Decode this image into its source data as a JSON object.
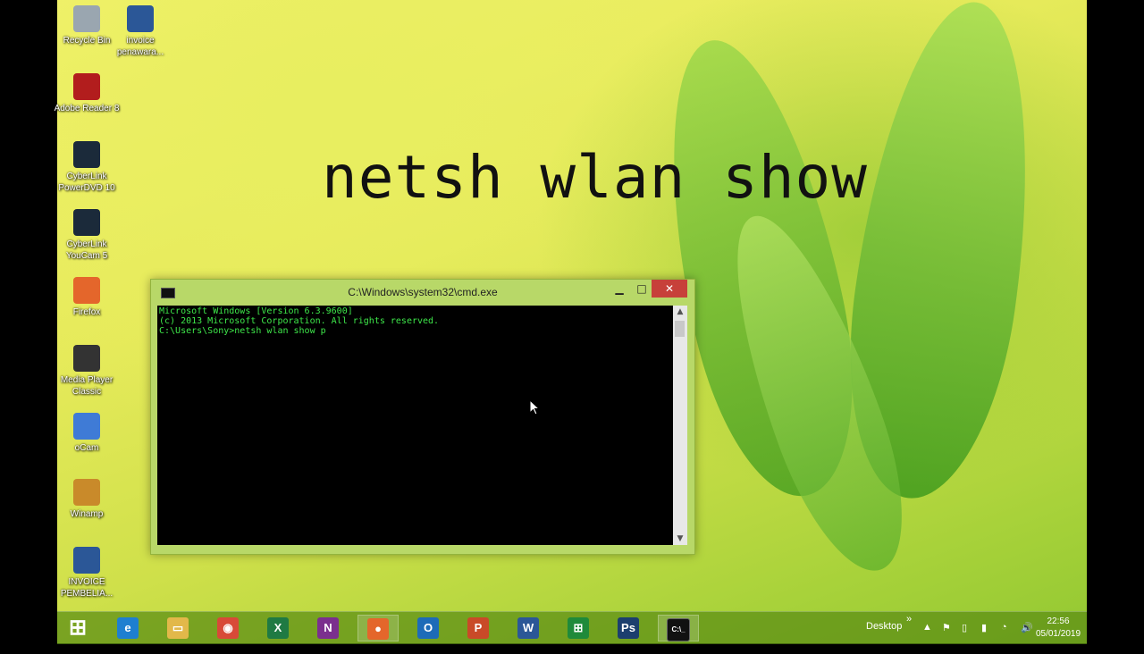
{
  "overlay_caption": "netsh wlan show",
  "desktop_icons": [
    {
      "name": "recycle-bin",
      "label": "Recycle Bin",
      "color": "#9aa6b0"
    },
    {
      "name": "invoice-penawaran",
      "label": "invoice penawara...",
      "color": "#2b5797"
    },
    {
      "name": "adobe-reader",
      "label": "Adobe Reader 8",
      "color": "#b21d1d"
    },
    {
      "name": "cyberlink-powerdvd",
      "label": "CyberLink PowerDVD 10",
      "color": "#1b2a3a"
    },
    {
      "name": "cyberlink-youcam",
      "label": "CyberLink YouCam 5",
      "color": "#1b2a3a"
    },
    {
      "name": "firefox",
      "label": "Firefox",
      "color": "#e4662b"
    },
    {
      "name": "media-player-classic",
      "label": "Media Player Classic",
      "color": "#333333"
    },
    {
      "name": "ocam",
      "label": "oCam",
      "color": "#3f7bd6"
    },
    {
      "name": "winamp",
      "label": "Winamp",
      "color": "#c98a2a"
    },
    {
      "name": "invoice-pembelian",
      "label": "INVOICE PEMBELIA...",
      "color": "#2b5797"
    }
  ],
  "cmd_window": {
    "title": "C:\\Windows\\system32\\cmd.exe",
    "minimize": "▁",
    "maximize": "□",
    "close": "✕",
    "lines": [
      "Microsoft Windows [Version 6.3.9600]",
      "(c) 2013 Microsoft Corporation. All rights reserved.",
      "",
      "C:\\Users\\Sony>netsh wlan show p"
    ]
  },
  "taskbar": {
    "apps": [
      {
        "name": "start-button",
        "icon": "windows-logo-icon",
        "glyph": "⊞",
        "color": "#ffffff"
      },
      {
        "name": "internet-explorer",
        "icon": "ie-icon",
        "glyph": "e",
        "color": "#1e7fd0"
      },
      {
        "name": "file-explorer",
        "icon": "folder-icon",
        "glyph": "▭",
        "color": "#e2b84a"
      },
      {
        "name": "chrome",
        "icon": "chrome-icon",
        "glyph": "◉",
        "color": "#d84a38"
      },
      {
        "name": "excel",
        "icon": "excel-icon",
        "glyph": "X",
        "color": "#1f7a43"
      },
      {
        "name": "onenote",
        "icon": "onenote-icon",
        "glyph": "N",
        "color": "#7b2f8e"
      },
      {
        "name": "firefox",
        "icon": "firefox-icon",
        "glyph": "●",
        "color": "#e4662b"
      },
      {
        "name": "outlook",
        "icon": "outlook-icon",
        "glyph": "O",
        "color": "#1d6bb8"
      },
      {
        "name": "powerpoint",
        "icon": "powerpoint-icon",
        "glyph": "P",
        "color": "#c94a28"
      },
      {
        "name": "word",
        "icon": "word-icon",
        "glyph": "W",
        "color": "#2b5797"
      },
      {
        "name": "store",
        "icon": "store-icon",
        "glyph": "⊞",
        "color": "#1f8a3a"
      },
      {
        "name": "photoshop",
        "icon": "photoshop-icon",
        "glyph": "Ps",
        "color": "#1c3f6e"
      },
      {
        "name": "command-prompt",
        "icon": "cmd-icon",
        "glyph": "C:\\_",
        "color": "#111111"
      }
    ],
    "desktop_label": "Desktop",
    "tray_chevron": "»",
    "tray_icons": [
      "▲",
      "⚑",
      "▯",
      "▮",
      "◔",
      "🔊"
    ],
    "time": "22:56",
    "date": "05/01/2019"
  }
}
